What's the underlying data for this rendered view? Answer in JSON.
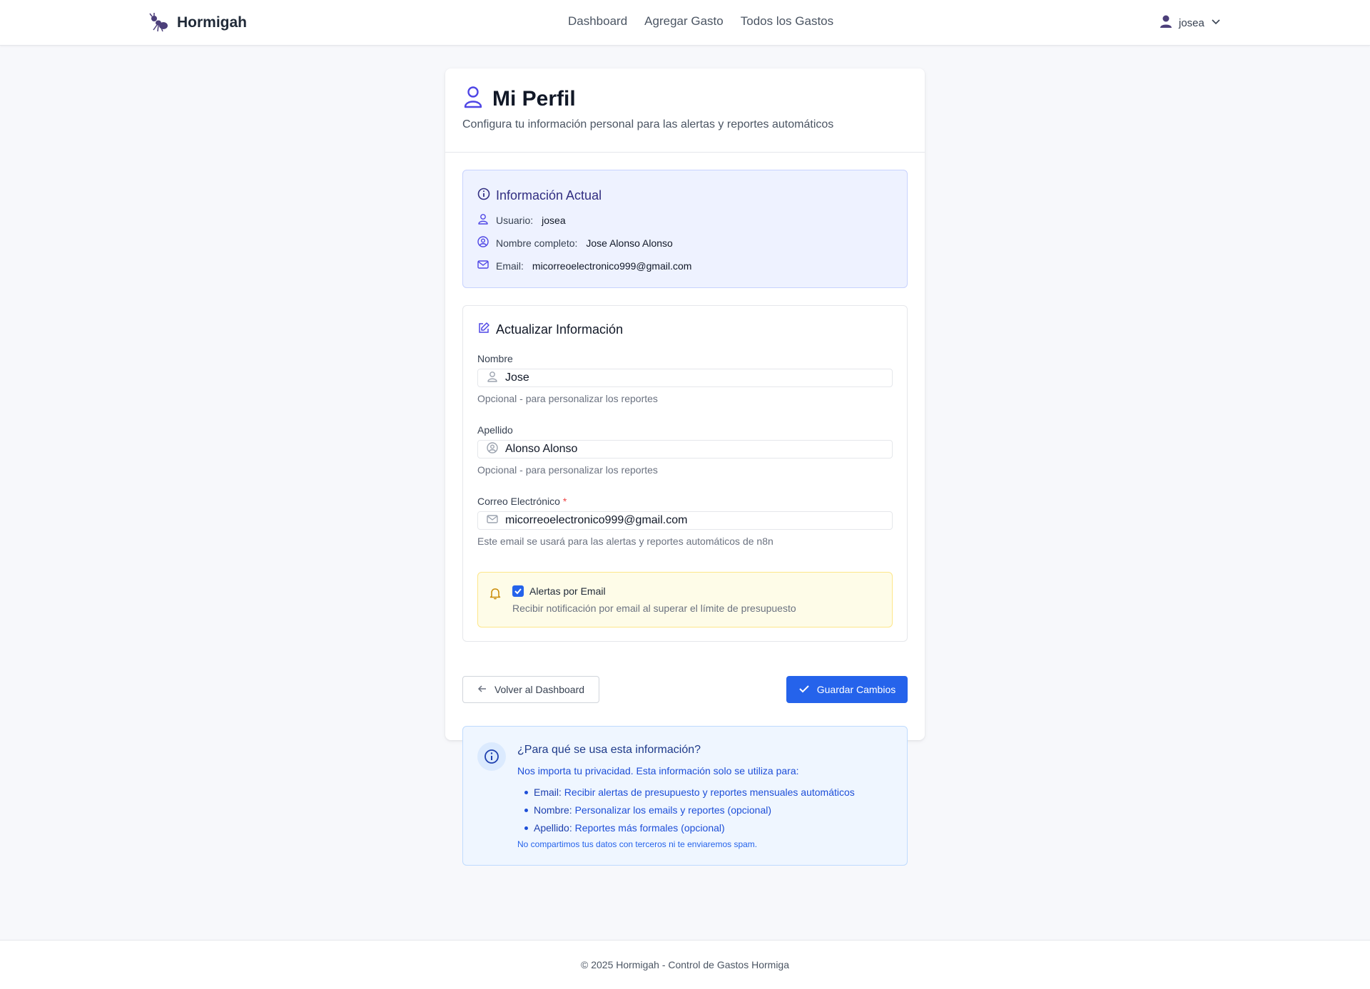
{
  "navbar": {
    "brand": "Hormigah",
    "links": [
      "Dashboard",
      "Agregar Gasto",
      "Todos los Gastos"
    ],
    "user": "josea",
    "brand_color": "#4c3f7a"
  },
  "page": {
    "title": "Mi Perfil",
    "subtitle": "Configura tu información personal para las alertas y reportes automáticos"
  },
  "current_info": {
    "title": "Información Actual",
    "rows": [
      {
        "label": "Usuario:",
        "value": "josea",
        "icon": "user-icon"
      },
      {
        "label": "Nombre completo:",
        "value": "Jose Alonso Alonso",
        "icon": "user-circle-icon"
      },
      {
        "label": "Email:",
        "value": "micorreoelectronico999@gmail.com",
        "icon": "mail-icon"
      }
    ]
  },
  "update": {
    "title": "Actualizar Información",
    "fields": {
      "nombre": {
        "label": "Nombre",
        "value": "Jose",
        "help": "Opcional - para personalizar los reportes"
      },
      "apellido": {
        "label": "Apellido",
        "value": "Alonso Alonso",
        "help": "Opcional - para personalizar los reportes"
      },
      "email": {
        "label": "Correo Electrónico",
        "required_mark": "*",
        "value": "micorreoelectronico999@gmail.com",
        "help": "Este email se usará para las alertas y reportes automáticos de n8n"
      }
    },
    "alerts": {
      "label": "Alertas por Email",
      "description": "Recibir notificación por email al superar el límite de presupuesto",
      "checked": true
    }
  },
  "actions": {
    "back": "Volver al Dashboard",
    "save": "Guardar Cambios"
  },
  "privacy": {
    "title": "¿Para qué se usa esta información?",
    "intro": "Nos importa tu privacidad. Esta información solo se utiliza para:",
    "items": [
      {
        "term": "Email:",
        "text": "Recibir alertas de presupuesto y reportes mensuales automáticos"
      },
      {
        "term": "Nombre:",
        "text": "Personalizar los emails y reportes (opcional)"
      },
      {
        "term": "Apellido:",
        "text": "Reportes más formales (opcional)"
      }
    ],
    "footnote": "No compartimos tus datos con terceros ni te enviaremos spam."
  },
  "footer": {
    "text": "© 2025 Hormigah - Control de Gastos Hormiga"
  }
}
